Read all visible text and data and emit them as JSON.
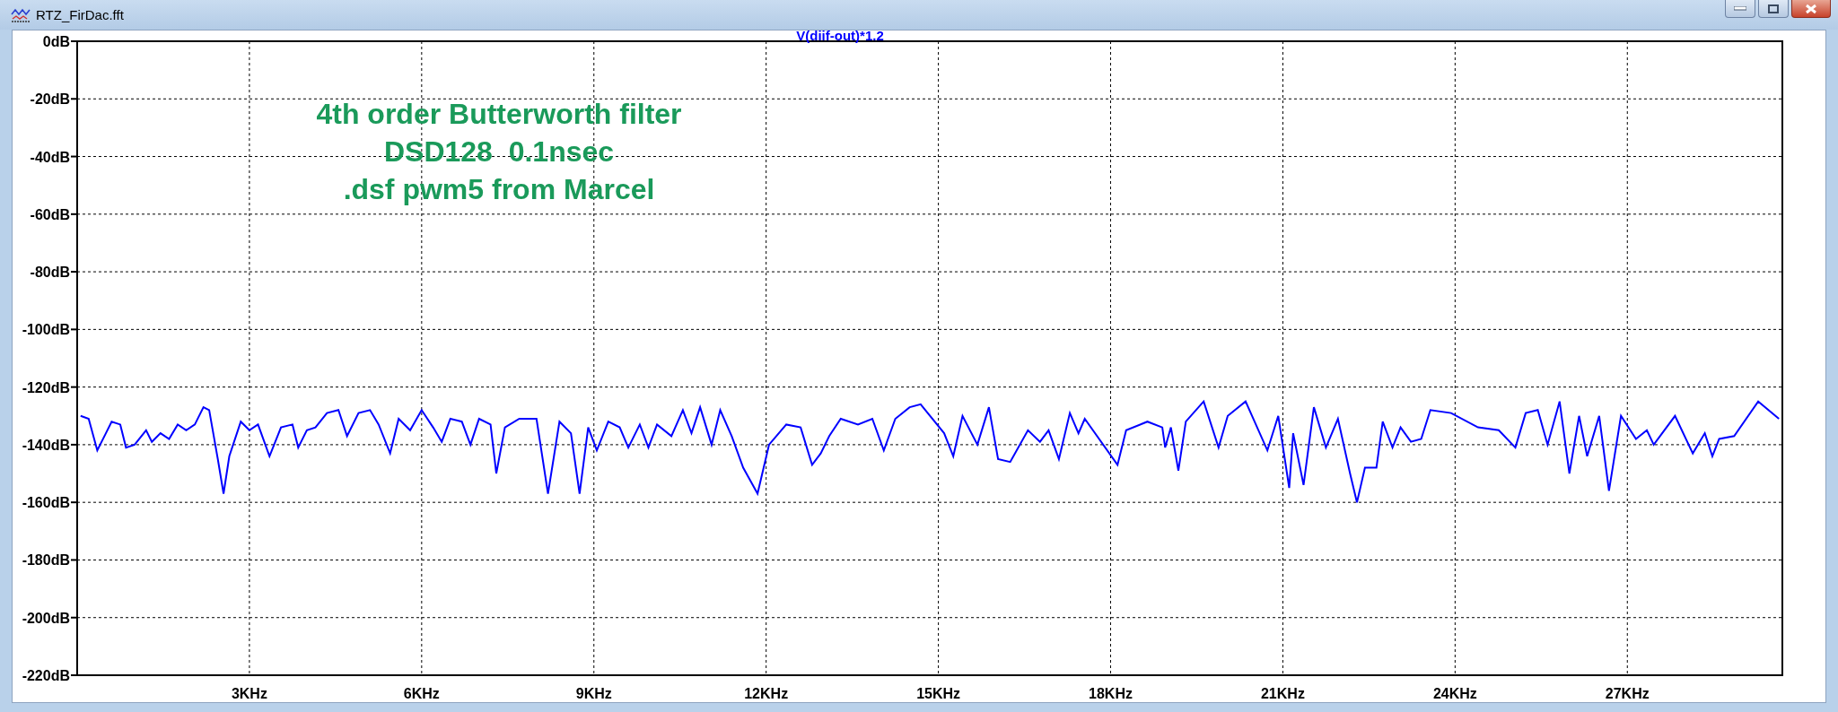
{
  "window": {
    "title": "RTZ_FirDac.fft"
  },
  "plot": {
    "chart_data": {
      "type": "line",
      "grid": true,
      "title": "V(diif-out)*1.2",
      "xlim": [
        0,
        29.7
      ],
      "ylim": [
        -220,
        0
      ],
      "xticks": [
        {
          "value": 3,
          "label": "3KHz"
        },
        {
          "value": 6,
          "label": "6KHz"
        },
        {
          "value": 9,
          "label": "9KHz"
        },
        {
          "value": 12,
          "label": "12KHz"
        },
        {
          "value": 15,
          "label": "15KHz"
        },
        {
          "value": 18,
          "label": "18KHz"
        },
        {
          "value": 21,
          "label": "21KHz"
        },
        {
          "value": 24,
          "label": "24KHz"
        },
        {
          "value": 27,
          "label": "27KHz"
        }
      ],
      "yticks": [
        {
          "value": 0,
          "label": "0dB"
        },
        {
          "value": -20,
          "label": "-20dB"
        },
        {
          "value": -40,
          "label": "-40dB"
        },
        {
          "value": -60,
          "label": "-60dB"
        },
        {
          "value": -80,
          "label": "-80dB"
        },
        {
          "value": -100,
          "label": "-100dB"
        },
        {
          "value": -120,
          "label": "-120dB"
        },
        {
          "value": -140,
          "label": "-140dB"
        },
        {
          "value": -160,
          "label": "-160dB"
        },
        {
          "value": -180,
          "label": "-180dB"
        },
        {
          "value": -200,
          "label": "-200dB"
        },
        {
          "value": -220,
          "label": "-220dB"
        }
      ],
      "x": [
        0.06,
        0.2,
        0.35,
        0.5,
        0.6,
        0.75,
        0.85,
        1.0,
        1.2,
        1.3,
        1.45,
        1.6,
        1.75,
        1.9,
        2.05,
        2.2,
        2.3,
        2.45,
        2.55,
        2.65,
        2.85,
        3.0,
        3.15,
        3.35,
        3.55,
        3.75,
        3.85,
        4.0,
        4.15,
        4.35,
        4.55,
        4.7,
        4.9,
        5.1,
        5.25,
        5.45,
        5.6,
        5.8,
        6.0,
        6.2,
        6.35,
        6.5,
        6.7,
        6.85,
        7.0,
        7.2,
        7.3,
        7.45,
        7.7,
        8.0,
        8.2,
        8.4,
        8.6,
        8.75,
        8.9,
        9.05,
        9.25,
        9.45,
        9.6,
        9.8,
        9.95,
        10.1,
        10.35,
        10.55,
        10.7,
        10.85,
        11.05,
        11.2,
        11.4,
        11.6,
        11.85,
        12.05,
        12.35,
        12.6,
        12.8,
        12.95,
        13.1,
        13.3,
        13.6,
        13.85,
        14.05,
        14.25,
        14.5,
        14.69,
        15.1,
        15.26,
        15.42,
        15.68,
        15.88,
        16.04,
        16.25,
        16.56,
        16.77,
        16.92,
        17.1,
        17.29,
        17.44,
        17.55,
        18.12,
        18.27,
        18.64,
        18.9,
        18.95,
        19.05,
        19.18,
        19.31,
        19.62,
        19.88,
        20.04,
        20.35,
        20.73,
        20.92,
        21.11,
        21.18,
        21.36,
        21.54,
        21.75,
        21.96,
        22.17,
        22.29,
        22.43,
        22.63,
        22.74,
        22.91,
        23.05,
        23.23,
        23.41,
        23.57,
        23.93,
        24.4,
        24.76,
        25.05,
        25.23,
        25.44,
        25.61,
        25.82,
        25.99,
        26.16,
        26.3,
        26.51,
        26.68,
        26.89,
        27.15,
        27.34,
        27.46,
        27.83,
        28.14,
        28.35,
        28.48,
        28.6,
        28.86,
        29.28,
        29.64
      ],
      "series": [
        {
          "color": "#0000ff",
          "values": [
            -130,
            -131,
            -142,
            -136,
            -132,
            -133,
            -141,
            -140,
            -135,
            -139,
            -136,
            -138,
            -133,
            -135,
            -133,
            -127,
            -128,
            -145,
            -157,
            -144,
            -132,
            -135,
            -133,
            -144,
            -134,
            -133,
            -141,
            -135,
            -134,
            -129,
            -128,
            -137,
            -129,
            -128,
            -133,
            -143,
            -131,
            -135,
            -128,
            -134,
            -139,
            -131,
            -132,
            -140,
            -131,
            -133,
            -150,
            -134,
            -131,
            -131,
            -157,
            -132,
            -136,
            -157,
            -134,
            -142,
            -132,
            -134,
            -141,
            -133,
            -141,
            -133,
            -137,
            -128,
            -136,
            -127,
            -140,
            -128,
            -137,
            -148,
            -157,
            -140,
            -133,
            -134,
            -147,
            -143,
            -137,
            -131,
            -133,
            -131,
            -142,
            -131,
            -127,
            -126,
            -136,
            -144,
            -130,
            -140,
            -127,
            -145,
            -146,
            -135,
            -139,
            -135,
            -145,
            -129,
            -136,
            -131,
            -147,
            -135,
            -132,
            -134,
            -141,
            -134,
            -149,
            -132,
            -125,
            -141,
            -130,
            -125,
            -142,
            -130,
            -155,
            -136,
            -154,
            -127,
            -141,
            -131,
            -150,
            -160,
            -148,
            -148,
            -132,
            -141,
            -134,
            -139,
            -138,
            -128,
            -129,
            -134,
            -135,
            -141,
            -129,
            -128,
            -140,
            -125,
            -150,
            -130,
            -144,
            -130,
            -156,
            -130,
            -138,
            -135,
            -140,
            -130,
            -143,
            -136,
            -144,
            -138,
            -137,
            -125,
            -131
          ]
        }
      ],
      "annotations": [
        {
          "text": "4th order Butterworth filter"
        },
        {
          "text": "DSD128  0.1nsec"
        },
        {
          "text": ".dsf pwm5 from Marcel"
        }
      ]
    }
  }
}
